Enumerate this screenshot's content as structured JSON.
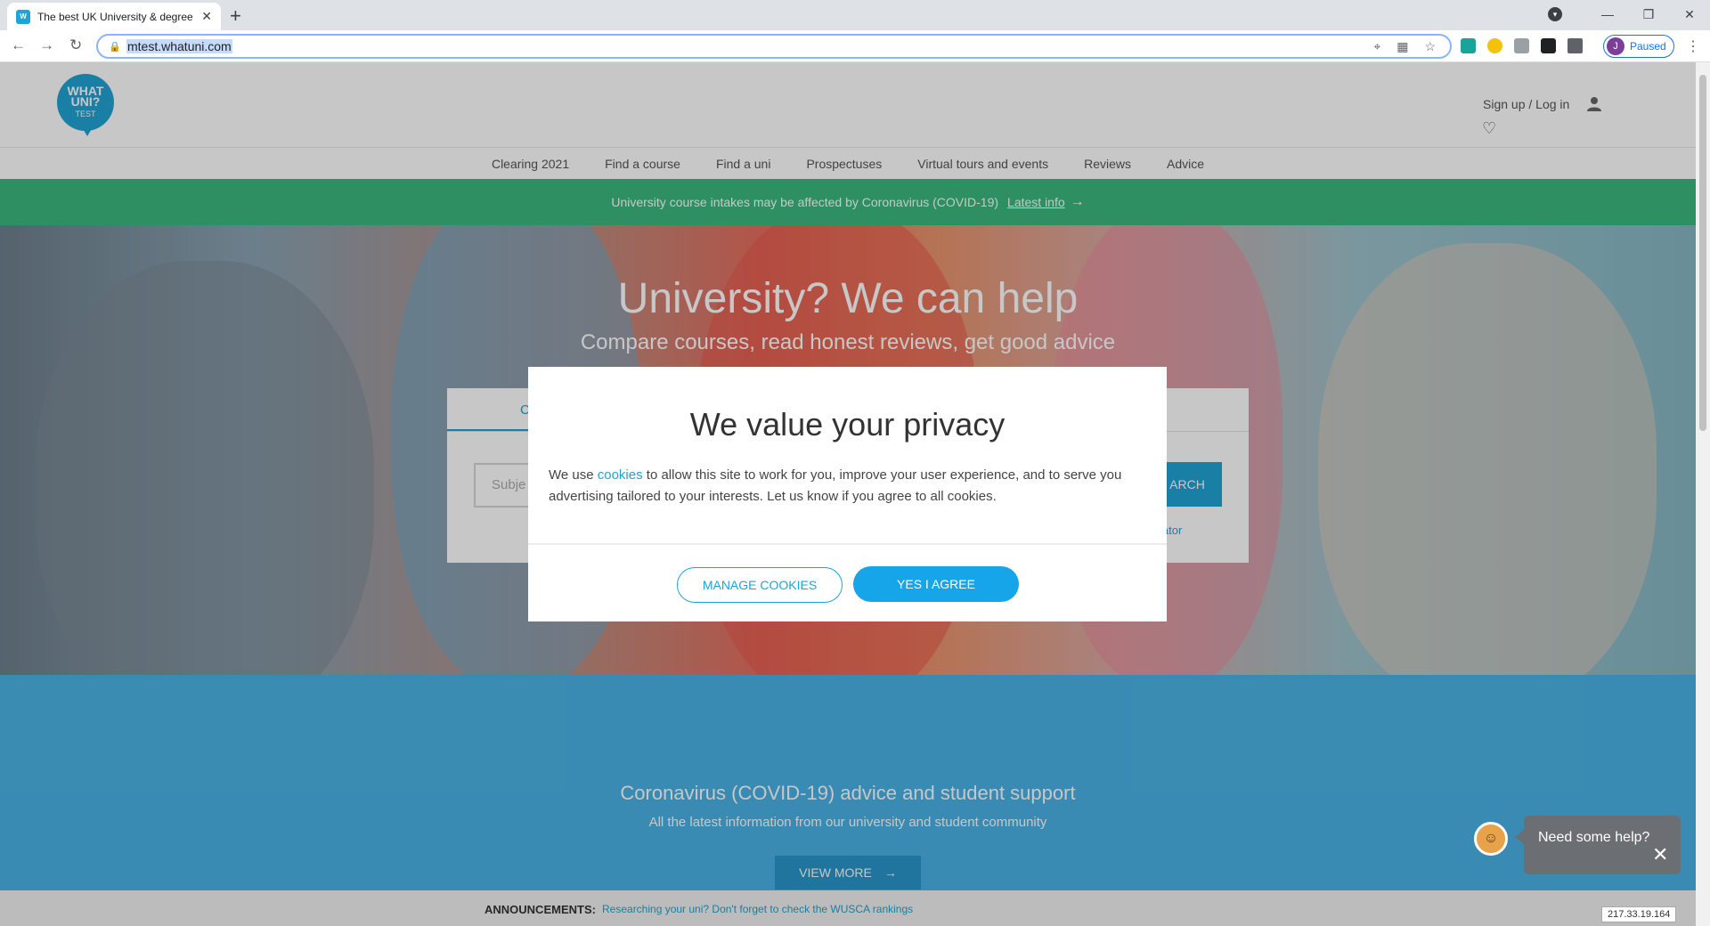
{
  "browser": {
    "tab_title": "The best UK University & degree",
    "tab_favicon_text": "W",
    "url": "mtest.whatuni.com",
    "profile_initial": "J",
    "profile_status": "Paused"
  },
  "header": {
    "logo_lines": [
      "WHAT",
      "UNI?",
      "TEST"
    ],
    "signup_label": "Sign up / Log in"
  },
  "nav": {
    "items": [
      "Clearing 2021",
      "Find a course",
      "Find a uni",
      "Prospectuses",
      "Virtual tours and events",
      "Reviews",
      "Advice"
    ]
  },
  "covid_bar": {
    "text": "University course intakes may be affected by Coronavirus (COVID-19)",
    "link": "Latest info"
  },
  "hero": {
    "title": "University? We can help",
    "subtitle": "Compare courses, read honest reviews, get good advice",
    "search_placeholder": "Subje",
    "tab_visible": "C",
    "search_button": "ARCH",
    "calc_link": "lator"
  },
  "support": {
    "title": "Coronavirus (COVID-19) advice and student support",
    "subtitle": "All the latest information from our university and student community",
    "button": "VIEW MORE"
  },
  "announcements": {
    "label": "ANNOUNCEMENTS:",
    "text": "Researching your uni? Don't forget to check the WUSCA rankings"
  },
  "ip_badge": "217.33.19.164",
  "chat": {
    "text": "Need some help?"
  },
  "modal": {
    "title": "We value your privacy",
    "body_before": "We use ",
    "body_link": "cookies",
    "body_after": " to allow this site to work for you, improve your user experience, and to serve you advertising tailored to your interests. Let us know if you agree to all cookies.",
    "manage_button": "MANAGE COOKIES",
    "agree_button": "YES I AGREE"
  },
  "colors": {
    "brand": "#20a3d4",
    "covid_green": "#3bb87e",
    "support_blue": "#4ab3e6"
  },
  "icons": [
    "lock-icon",
    "back-icon",
    "forward-icon",
    "reload-icon",
    "location-icon",
    "star-icon",
    "extensions-icon",
    "user-icon",
    "heart-icon",
    "arrow-right-icon",
    "close-icon",
    "chatbot-icon"
  ]
}
